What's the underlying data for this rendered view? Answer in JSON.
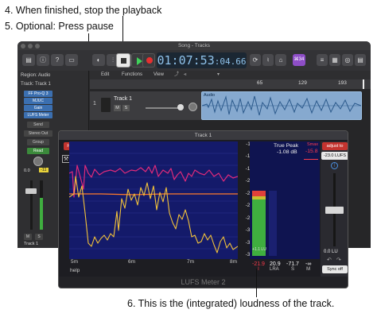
{
  "annotations": {
    "step4": "4. When finished, stop the playback",
    "step5": "5. Optional: Press pause",
    "step6": "6. This is the (integrated) loudness of the track."
  },
  "window": {
    "title": "Song - Tracks"
  },
  "toolbar": {
    "timecode_main": "01:07:53",
    "timecode_sub": ":04.66",
    "badge_count": "⌘34"
  },
  "inspector": {
    "region_label": "Region: Audio",
    "track_label": "Track:",
    "track_name": "Track 1",
    "plugins": [
      "FF Pro-Q 3",
      "MJUC",
      "Gain",
      "LUFS Meter"
    ],
    "send_label": "Send",
    "output_label": "Stereo Out",
    "group_label": "Group",
    "automation_label": "Read",
    "volume_value": "0.0",
    "peak_value": "-11",
    "mute_label": "M",
    "solo_label": "S",
    "channel_name": "Track 1"
  },
  "tracks_area": {
    "menus": [
      "Edit",
      "Functions",
      "View"
    ],
    "ruler_marks": [
      "65",
      "129",
      "193"
    ],
    "track_name": "Track 1",
    "track_number": "1",
    "mute_label": "M",
    "solo_label": "S",
    "region_label": "Audio"
  },
  "plugin": {
    "window_title": "Track 1",
    "reset_label": "reset",
    "pause_label": "pause",
    "adjust_label": "adjust to",
    "target_value": "-23.0 LUFS",
    "true_peak_label": "True Peak",
    "true_peak_value": "-1.08 dB",
    "smax_label": "Smax",
    "smax_value": "-15.8",
    "scale_ticks": [
      "-11",
      "-14",
      "-17",
      "-20",
      "-23",
      "-26",
      "-29",
      "-32",
      "-35",
      "-38"
    ],
    "lu_label": "+1.1 LU",
    "integrated_value": "-21.9",
    "integrated_label": "I",
    "lra_value": "20.9",
    "lra_label": "LRA",
    "short_value": "-71.7",
    "short_label": "S",
    "momentary_value": "-∞",
    "momentary_label": "M",
    "gain_value": "0.0 LU",
    "sync_label": "Sync off",
    "time_labels": [
      "5m",
      "6m",
      "7m",
      "8m"
    ],
    "help_label": "help",
    "footer_title": "LUFS Meter 2",
    "colors": {
      "graph_bg": "#141a6a",
      "momentary_line": "#f2c23a",
      "shortterm_line": "#e02a7a",
      "target_line": "#ff7a2a",
      "meter_green": "#3fae3f",
      "meter_red": "#e0403a"
    }
  }
}
